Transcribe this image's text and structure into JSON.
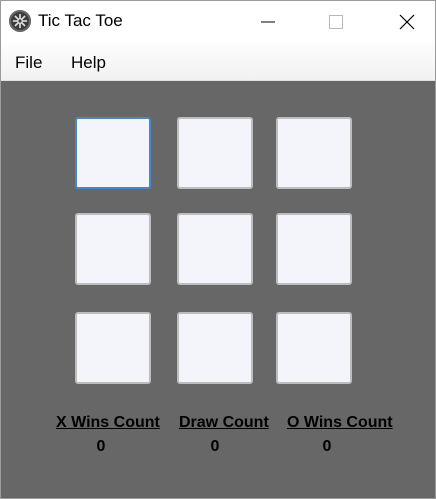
{
  "window": {
    "title": "Tic Tac Toe",
    "icon": "app-icon"
  },
  "menu": {
    "items": [
      {
        "label": "File"
      },
      {
        "label": "Help"
      }
    ]
  },
  "board": {
    "cells": [
      "",
      "",
      "",
      "",
      "",
      "",
      "",
      "",
      ""
    ],
    "focused_cell": 0
  },
  "stats": {
    "x_wins_label": "X Wins Count",
    "x_wins_value": "0",
    "draw_label": "Draw Count",
    "draw_value": "0",
    "o_wins_label": "O Wins Count",
    "o_wins_value": "0"
  },
  "colors": {
    "client_background": "#676767",
    "cell_background": "#f3f5fa",
    "focus_border": "#4a86c8"
  }
}
